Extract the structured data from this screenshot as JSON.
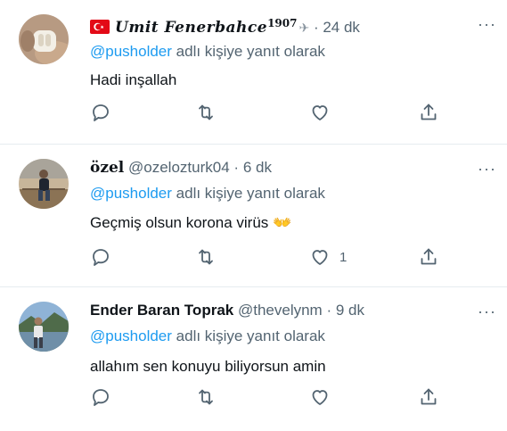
{
  "tweets": [
    {
      "display_name": "Umit Fenerbahce",
      "name_suffix": "1907",
      "handle": "",
      "separator": "·",
      "time": "24 dk",
      "reply_prefix": "@pusholder",
      "reply_suffix": "adlı kişiye yanıt olarak",
      "text": "Hadi inşallah",
      "like_count": ""
    },
    {
      "display_name": "özel",
      "name_suffix": "",
      "handle": "@ozelozturk04",
      "separator": "·",
      "time": "6 dk",
      "reply_prefix": "@pusholder",
      "reply_suffix": "adlı kişiye yanıt olarak",
      "text": "Geçmiş olsun korona virüs 👐",
      "like_count": "1"
    },
    {
      "display_name": "Ender Baran Toprak",
      "name_suffix": "",
      "handle": "@thevelynm",
      "separator": "·",
      "time": "9 dk",
      "reply_prefix": "@pusholder",
      "reply_suffix": "adlı kişiye yanıt olarak",
      "text": "allahım sen konuyu biliyorsun amin",
      "like_count": ""
    }
  ],
  "more_label": "···",
  "colors": {
    "mention": "#1d9bf0",
    "muted": "#536471",
    "text": "#0f1419",
    "divider": "#e6ecf0"
  },
  "icons": [
    "reply-icon",
    "retweet-icon",
    "like-icon",
    "share-icon",
    "more-icon",
    "turkey-flag-icon",
    "bird-glyph-icon"
  ]
}
